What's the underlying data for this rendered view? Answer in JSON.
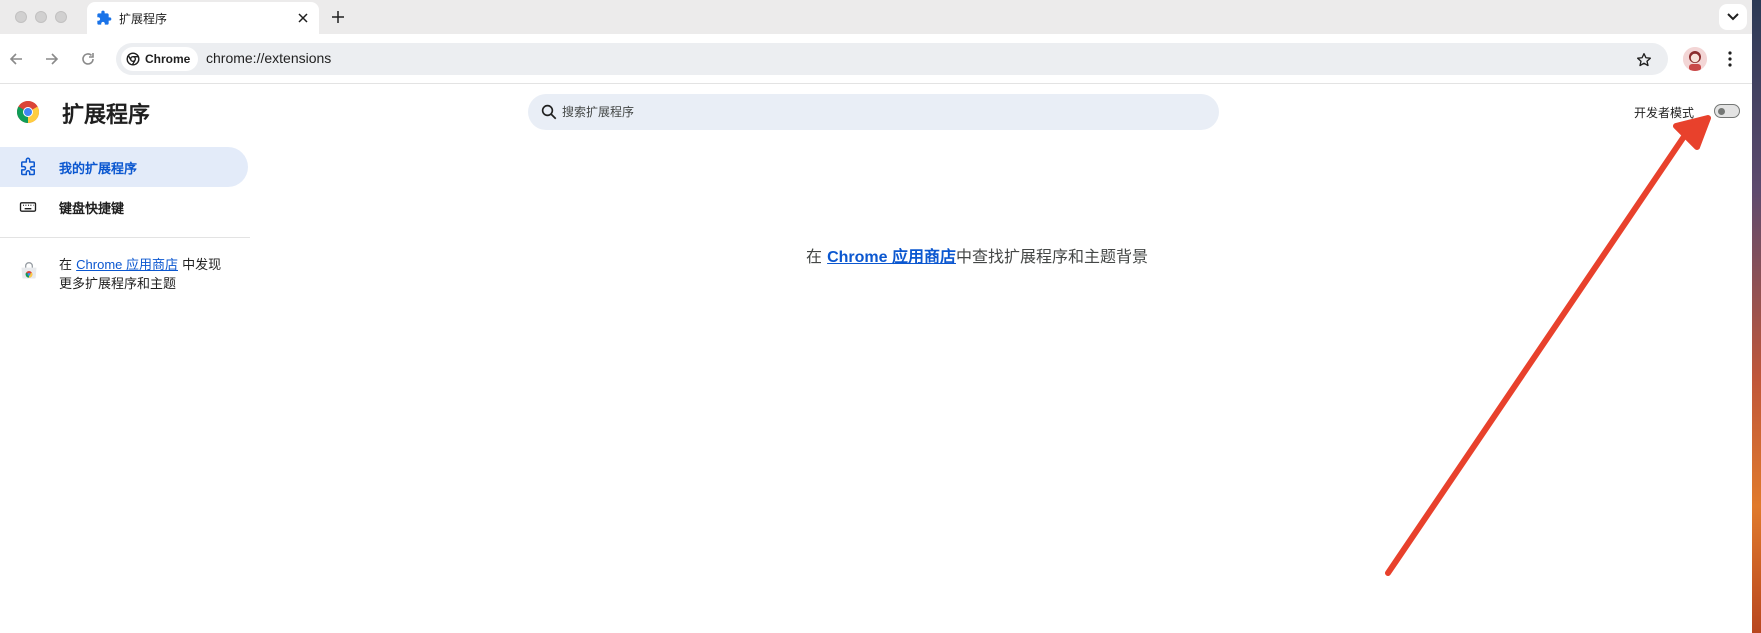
{
  "colors": {
    "accent": "#0b57d0",
    "active_bg": "#e3ebf9",
    "search_bg": "#e9eef6",
    "annotation_arrow": "#e8412c"
  },
  "tab": {
    "icon": "puzzle-icon",
    "title": "扩展程序"
  },
  "toolbar": {
    "site_chip_label": "Chrome",
    "url": "chrome://extensions"
  },
  "page": {
    "title": "扩展程序",
    "search_placeholder": "搜索扩展程序",
    "dev_mode_label": "开发者模式",
    "dev_mode_enabled": false
  },
  "sidebar": {
    "items": [
      {
        "label": "我的扩展程序",
        "icon": "extensions-icon",
        "active": true
      },
      {
        "label": "键盘快捷键",
        "icon": "keyboard-icon",
        "active": false
      }
    ],
    "store_promo": {
      "prefix": "在 ",
      "link": "Chrome 应用商店",
      "suffix": " 中发现更多扩展程序和主题"
    }
  },
  "empty_state": {
    "prefix": "在 ",
    "link": "Chrome 应用商店",
    "suffix": "中查找扩展程序和主题背景"
  }
}
